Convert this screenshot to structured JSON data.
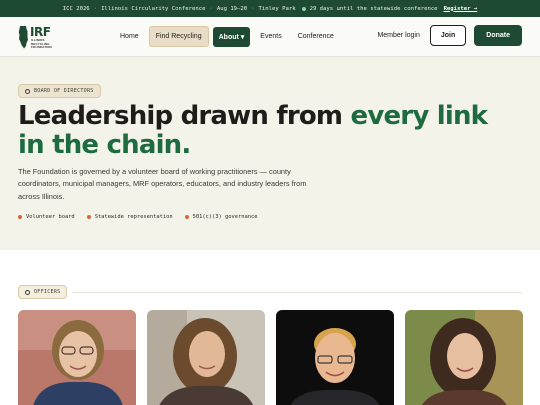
{
  "announcement": {
    "event": "ICC 2026",
    "title": "Illinois Circularity Conference",
    "dates": "Aug 19–20",
    "location": "Tinley Park",
    "countdown": "29 days until the statewide conference",
    "register_label": "Register →",
    "separator": "·"
  },
  "logo": {
    "mark": "IRF",
    "subtitle": [
      "ILLINOIS",
      "RECYCLING",
      "FOUNDATION"
    ],
    "icon": "illinois-state-outline-icon"
  },
  "nav": {
    "items": [
      "Home",
      "Find Recycling",
      "About ▾",
      "Events",
      "Conference"
    ],
    "login_label": "Member login",
    "join_label": "Join",
    "donate_label": "Donate"
  },
  "hero": {
    "eyebrow": "BOARD OF DIRECTORS",
    "headline_part1": "Leadership drawn from ",
    "headline_accent1": "every link",
    "headline_accent2": "in the chain.",
    "lede": "The Foundation is governed by a volunteer board of working practitioners — county coordinators, municipal managers, MRF operators, educators, and industry leaders from across Illinois.",
    "tags": [
      "Volunteer board",
      "Statewide representation",
      "501(c)(3) governance"
    ]
  },
  "officers": {
    "eyebrow": "OFFICERS",
    "portraits": [
      "portrait-1",
      "portrait-2",
      "portrait-3",
      "portrait-4"
    ]
  },
  "colors": {
    "brand_green": "#1e4a33",
    "accent_green": "#1e6b3f",
    "cream": "#f4f3ea",
    "tag_dot": "#d9673d"
  }
}
